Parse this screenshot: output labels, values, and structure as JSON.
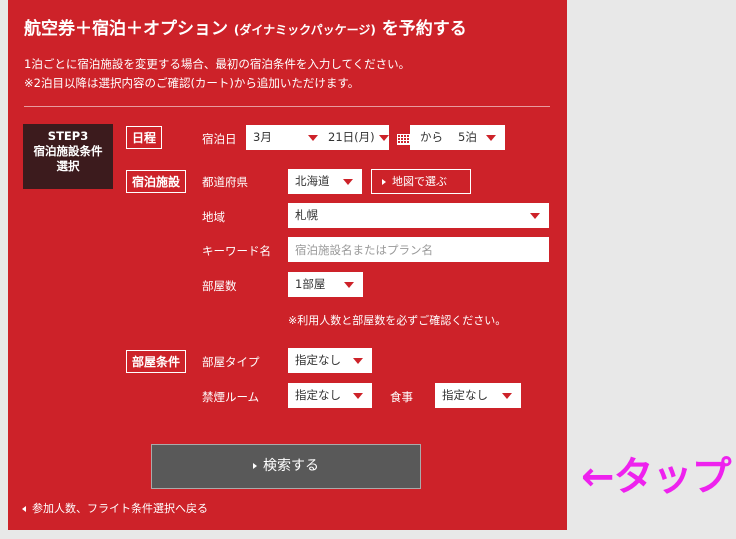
{
  "header": {
    "title": "航空券＋宿泊＋オプション",
    "subtitle": "(ダイナミックパッケージ)",
    "title_suffix": "を予約する"
  },
  "description": {
    "line1": "1泊ごとに宿泊施設を変更する場合、最初の宿泊条件を入力してください。",
    "line2": "※2泊目以降は選択内容のご確認(カート)から追加いただけます。"
  },
  "step": {
    "line1": "STEP3",
    "line2": "宿泊施設条件",
    "line3": "選択"
  },
  "schedule": {
    "section_label": "日程",
    "checkin_label": "宿泊日",
    "month": "3月",
    "day": "21日(月)",
    "from_text": "から",
    "nights": "5泊"
  },
  "facility": {
    "section_label": "宿泊施設",
    "prefecture_label": "都道府県",
    "prefecture": "北海道",
    "map_button": "地図で選ぶ",
    "area_label": "地域",
    "area": "札幌",
    "keyword_label": "キーワード名",
    "keyword_placeholder": "宿泊施設名またはプラン名",
    "rooms_label": "部屋数",
    "rooms": "1部屋",
    "note": "※利用人数と部屋数を必ずご確認ください。"
  },
  "room_conditions": {
    "section_label": "部屋条件",
    "room_type_label": "部屋タイプ",
    "room_type": "指定なし",
    "smoking_label": "禁煙ルーム",
    "smoking": "指定なし",
    "meal_label": "食事",
    "meal": "指定なし"
  },
  "actions": {
    "search_button": "検索する",
    "back_link": "参加人数、フライト条件選択へ戻る"
  },
  "annotation": {
    "tap": "←タップ"
  },
  "colors": {
    "panel": "#cd2229",
    "step_box": "#3c1b1d",
    "search_button": "#595959",
    "annotation": "#ee22ee"
  }
}
